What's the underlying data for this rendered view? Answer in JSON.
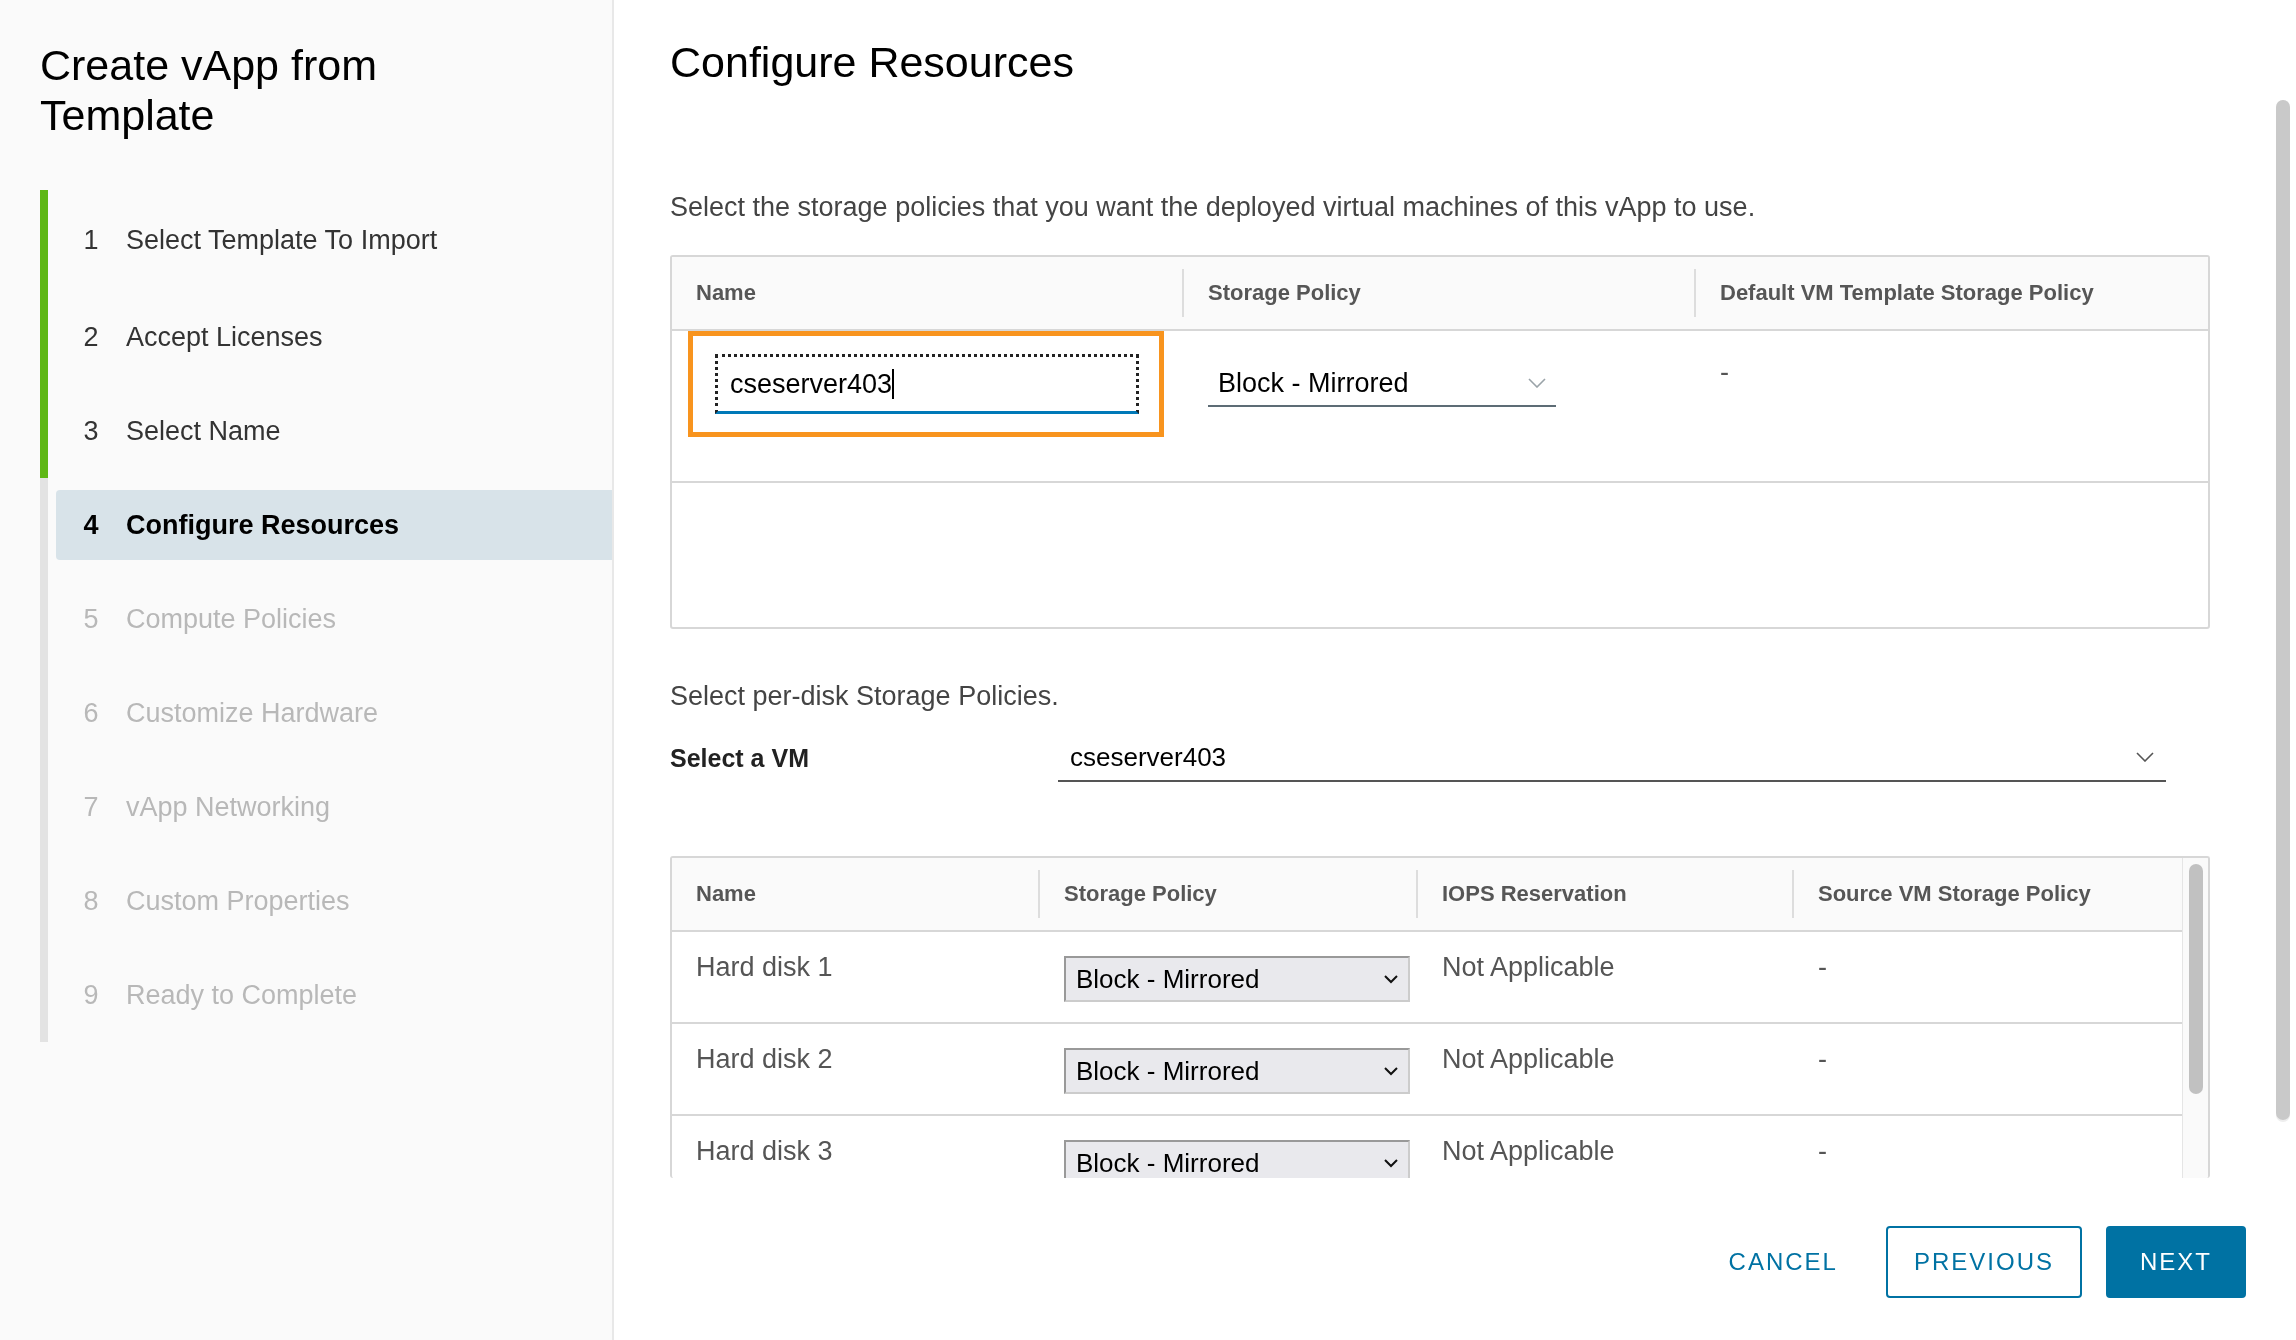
{
  "wizard": {
    "title": "Create vApp from Template",
    "steps": [
      {
        "number": "1",
        "label": "Select Template To Import",
        "completed": true,
        "selected": false,
        "disabled": false
      },
      {
        "number": "2",
        "label": "Accept Licenses",
        "completed": true,
        "selected": false,
        "disabled": false
      },
      {
        "number": "3",
        "label": "Select Name",
        "completed": true,
        "selected": false,
        "disabled": false
      },
      {
        "number": "4",
        "label": "Configure Resources",
        "completed": false,
        "selected": true,
        "disabled": false
      },
      {
        "number": "5",
        "label": "Compute Policies",
        "completed": false,
        "selected": false,
        "disabled": true
      },
      {
        "number": "6",
        "label": "Customize Hardware",
        "completed": false,
        "selected": false,
        "disabled": true
      },
      {
        "number": "7",
        "label": "vApp Networking",
        "completed": false,
        "selected": false,
        "disabled": true
      },
      {
        "number": "8",
        "label": "Custom Properties",
        "completed": false,
        "selected": false,
        "disabled": true
      },
      {
        "number": "9",
        "label": "Ready to Complete",
        "completed": false,
        "selected": false,
        "disabled": true
      }
    ]
  },
  "page": {
    "title": "Configure Resources",
    "description": "Select the storage policies that you want the deployed virtual machines of this vApp to use."
  },
  "vm_table": {
    "columns": [
      "Name",
      "Storage Policy",
      "Default VM Template Storage Policy"
    ],
    "rows": [
      {
        "name": "cseserver403",
        "highlighted": true,
        "storage_policy": "Block - Mirrored",
        "default_policy": "-"
      }
    ]
  },
  "disk_section": {
    "title": "Select per-disk Storage Policies.",
    "vm_label": "Select a VM",
    "vm_value": "cseserver403"
  },
  "disk_table": {
    "columns": [
      "Name",
      "Storage Policy",
      "IOPS Reservation",
      "Source VM Storage Policy"
    ],
    "rows": [
      {
        "name": "Hard disk 1",
        "storage_policy": "Block - Mirrored",
        "iops": "Not Applicable",
        "source_policy": "-"
      },
      {
        "name": "Hard disk 2",
        "storage_policy": "Block - Mirrored",
        "iops": "Not Applicable",
        "source_policy": "-"
      },
      {
        "name": "Hard disk 3",
        "storage_policy": "Block - Mirrored",
        "iops": "Not Applicable",
        "source_policy": "-"
      }
    ]
  },
  "buttons": [
    {
      "label": "CANCEL",
      "kind": "link"
    },
    {
      "label": "PREVIOUS",
      "kind": "outline"
    },
    {
      "label": "NEXT",
      "kind": "primary"
    }
  ]
}
